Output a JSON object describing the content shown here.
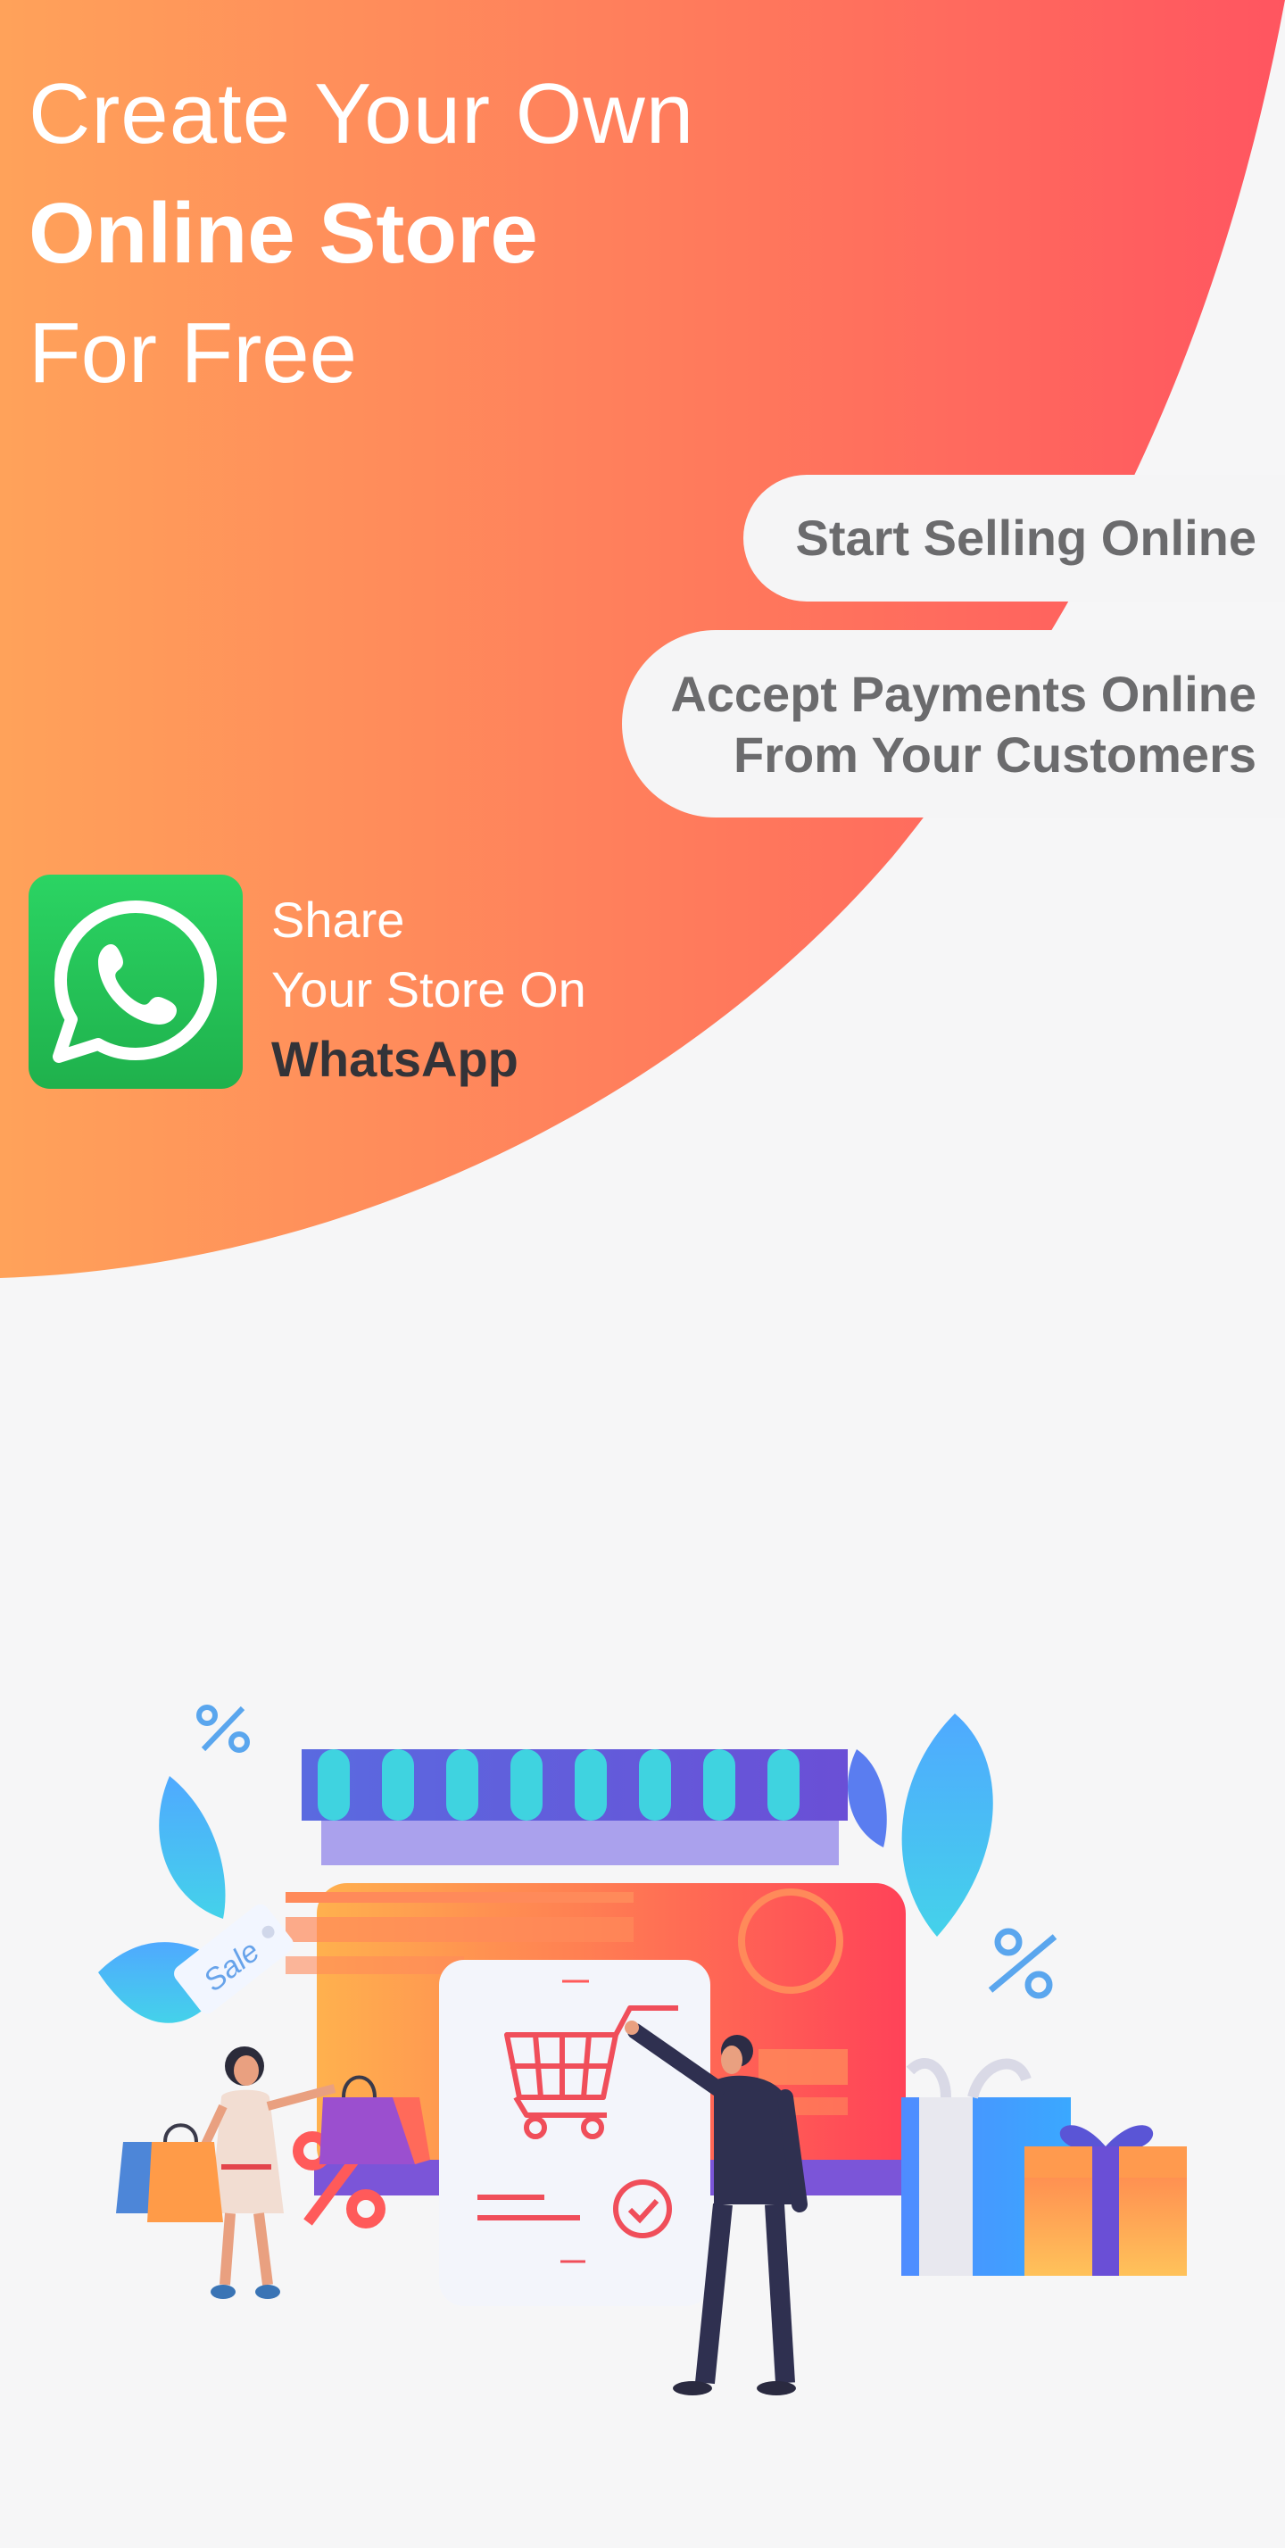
{
  "headline": {
    "line1": "Create Your Own",
    "line2": "Online Store",
    "line3": "For Free"
  },
  "features": {
    "start_selling": "Start Selling Online",
    "accept_payments_line1": "Accept Payments Online",
    "accept_payments_line2": "From Your Customers"
  },
  "share": {
    "line1": "Share",
    "line2": "Your Store On",
    "line3": "WhatsApp",
    "icon": "whatsapp-icon"
  },
  "illustration": {
    "sale_tag": "Sale",
    "icons": [
      "shop-icon",
      "shopping-cart-icon",
      "gift-icon",
      "shopping-bag-icon",
      "percent-icon"
    ]
  },
  "colors": {
    "gradient_start": "#ffa25a",
    "gradient_end": "#ff5560",
    "whatsapp_green": "#25c45a",
    "pill_text": "#6b6b6d",
    "background": "#f6f6f7"
  }
}
